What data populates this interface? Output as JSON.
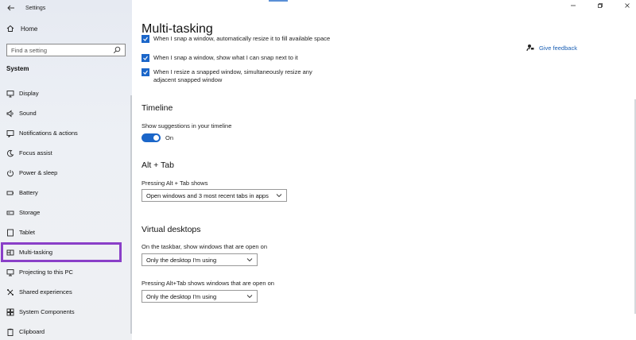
{
  "window": {
    "app_title": "Settings",
    "controls": [
      "minimize",
      "maximize",
      "close"
    ]
  },
  "sidebar": {
    "home_label": "Home",
    "search_placeholder": "Find a setting",
    "section_label": "System",
    "items": [
      {
        "label": "Display",
        "icon": "display-icon"
      },
      {
        "label": "Sound",
        "icon": "sound-icon"
      },
      {
        "label": "Notifications & actions",
        "icon": "notifications-icon"
      },
      {
        "label": "Focus assist",
        "icon": "focus-assist-icon"
      },
      {
        "label": "Power & sleep",
        "icon": "power-icon"
      },
      {
        "label": "Battery",
        "icon": "battery-icon"
      },
      {
        "label": "Storage",
        "icon": "storage-icon"
      },
      {
        "label": "Tablet",
        "icon": "tablet-icon"
      },
      {
        "label": "Multi-tasking",
        "icon": "multitasking-icon",
        "highlighted": true
      },
      {
        "label": "Projecting to this PC",
        "icon": "projecting-icon"
      },
      {
        "label": "Shared experiences",
        "icon": "shared-experiences-icon"
      },
      {
        "label": "System Components",
        "icon": "system-components-icon"
      },
      {
        "label": "Clipboard",
        "icon": "clipboard-icon"
      }
    ],
    "highlight_color": "#8a3fc8"
  },
  "main": {
    "title": "Multi-tasking",
    "feedback_label": "Give feedback",
    "snap_options": [
      {
        "label": "When I snap a window, automatically resize it to fill available space",
        "checked": true
      },
      {
        "label": "When I snap a window, show what I can snap next to it",
        "checked": true
      },
      {
        "label": "When I resize a snapped window, simultaneously resize any adjacent snapped window",
        "checked": true
      }
    ],
    "timeline": {
      "title": "Timeline",
      "label": "Show suggestions in your timeline",
      "toggle_state": "On"
    },
    "alt_tab": {
      "title": "Alt + Tab",
      "label": "Pressing Alt + Tab shows",
      "value": "Open windows and 3 most recent tabs in apps"
    },
    "virtual_desktops": {
      "title": "Virtual desktops",
      "taskbar_label": "On the taskbar, show windows that are open on",
      "taskbar_value": "Only the desktop I'm using",
      "alttab_label": "Pressing Alt+Tab shows windows that are open on",
      "alttab_value": "Only the desktop I'm using"
    },
    "accent_color": "#1b66c9",
    "link_color": "#1a5fb4"
  }
}
